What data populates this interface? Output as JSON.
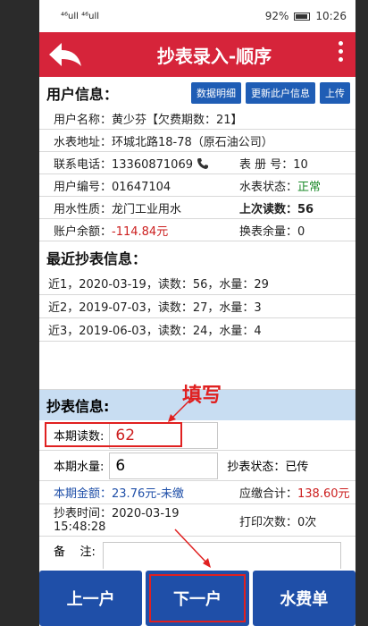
{
  "status_bar": {
    "signal": "⁴⁶ull ⁴⁶ull",
    "battery": "92%",
    "time": "10:26"
  },
  "header": {
    "title": "抄表录入-顺序"
  },
  "user_section": {
    "title": "用户信息：",
    "buttons": [
      "数据明细",
      "更新此户信息",
      "上传"
    ],
    "name_row": "用户名称：黄少芬【欠费期数：21】",
    "address_row": "水表地址：环城北路18-78（原石油公司）",
    "phone_label": "联系电话：13360871069",
    "book_label": "表 册 号：10",
    "user_no_label": "用户编号：01647104",
    "meter_state_label": "水表状态：",
    "meter_state_value": "正常",
    "usage_label": "用水性质：龙门工业用水",
    "last_read_label": "上次读数：56",
    "balance_label": "账户余额：",
    "balance_value": "-114.84元",
    "meter_remain_label": "换表余量：0"
  },
  "recent_section": {
    "title": "最近抄表信息：",
    "items": [
      "近1，2020-03-19，读数：56，水量：29",
      "近2，2019-07-03，读数：27，水量：3",
      "近3，2019-06-03，读数：24，水量：4"
    ]
  },
  "meter_section": {
    "title": "抄表信息:",
    "annotation": "填写",
    "reading_label": "本期读数:",
    "reading_value": "62",
    "volume_label": "本期水量:",
    "volume_value": "6",
    "read_state_label": "抄表状态：已传",
    "amount_label": "本期金额：",
    "amount_value": "23.76元-未缴",
    "total_label": "应缴合计：",
    "total_value": "138.60元",
    "time_label": "抄表时间：",
    "time_value1": "2020-03-19",
    "time_value2": "15:48:28",
    "print_label": "打印次数：0次",
    "remark_label": "备    注:"
  },
  "bottom_nav": {
    "prev": "上一户",
    "next": "下一户",
    "bill": "水费单"
  },
  "colors": {
    "title_bar": "#d6243a",
    "button_blue": "#1f4fa8",
    "annotation_red": "#e02020",
    "section_blue": "#c8ddf2"
  }
}
